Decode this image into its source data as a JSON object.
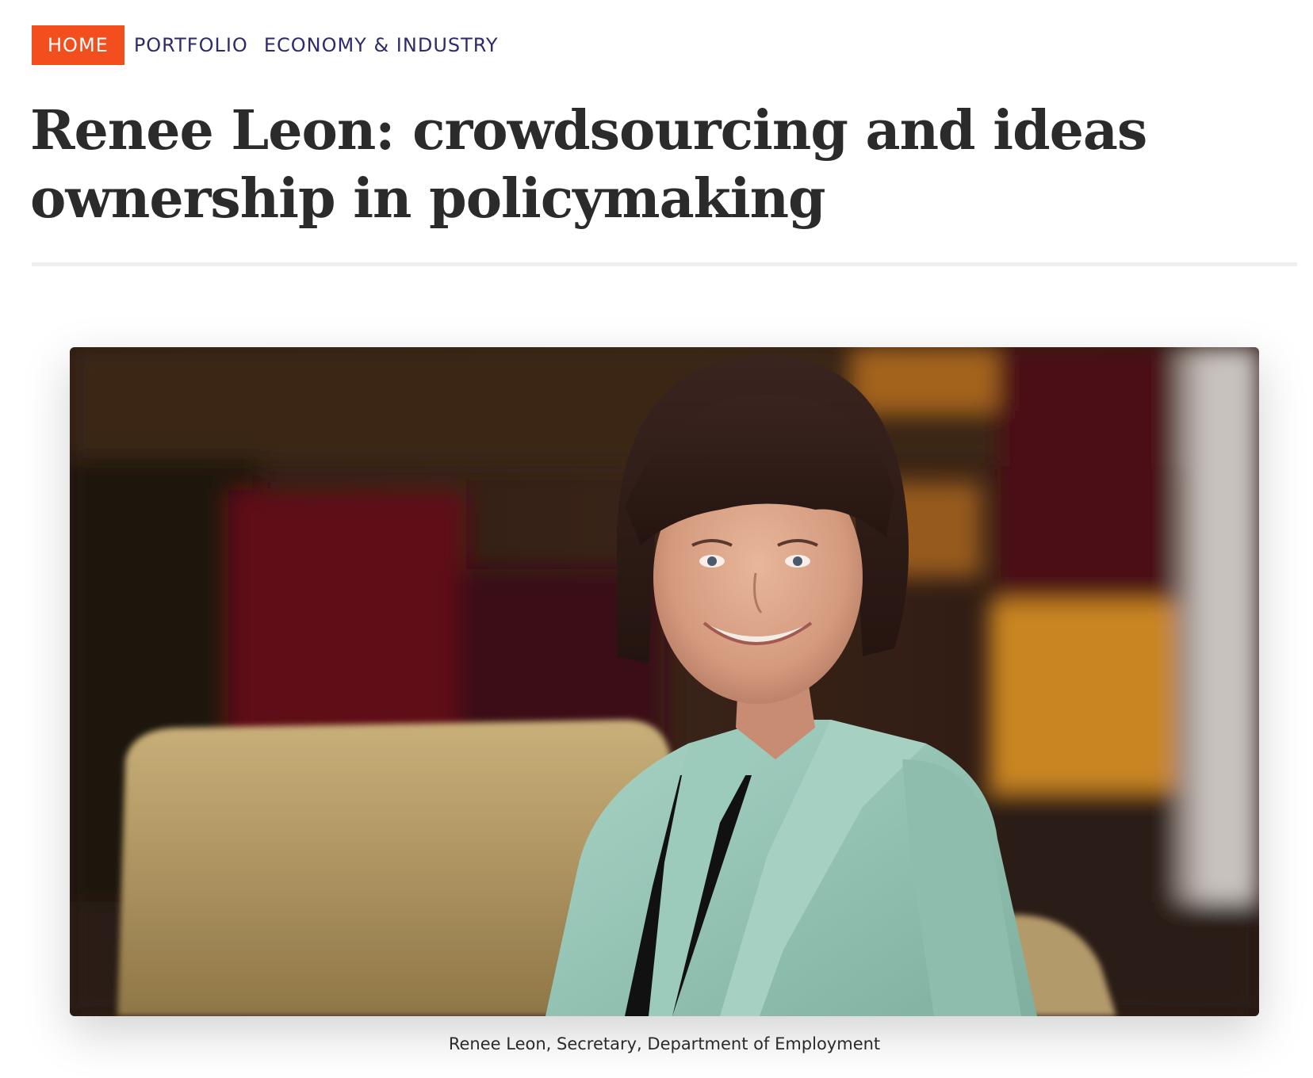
{
  "breadcrumb": {
    "home": "HOME",
    "portfolio": "PORTFOLIO",
    "section": "ECONOMY & INDUSTRY"
  },
  "article": {
    "title": "Renee Leon: crowdsourcing and ideas ownership in policymaking",
    "image_caption": "Renee Leon, Secretary, Department of Employment"
  },
  "colors": {
    "home_badge": "#f24e1e",
    "nav_link": "#2e2a6b",
    "title_text": "#2b2b2b"
  }
}
